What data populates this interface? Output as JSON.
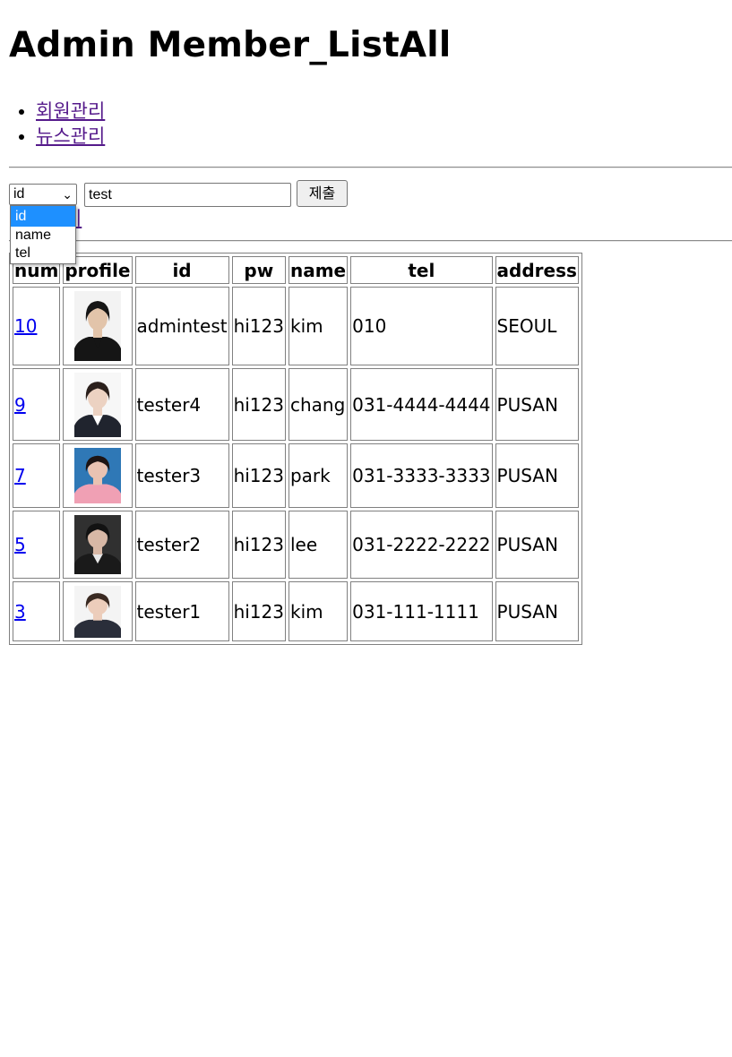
{
  "page": {
    "title": "Admin Member_ListAll"
  },
  "nav": {
    "items": [
      {
        "label": "회원관리"
      },
      {
        "label": "뉴스관리"
      }
    ]
  },
  "search": {
    "selected": "id",
    "options": [
      "id",
      "name",
      "tel"
    ],
    "query": "test",
    "submit_label": "제출",
    "write_link": "작성하기",
    "write_link_visible": "하기"
  },
  "table": {
    "headers": [
      "num",
      "profile",
      "id",
      "pw",
      "name",
      "tel",
      "address"
    ],
    "rows": [
      {
        "num": "10",
        "id": "admintest",
        "pw": "hi123",
        "name": "kim",
        "tel": "010",
        "address": "SEOUL",
        "photo": {
          "bg": "#f3f3f3",
          "hair": "#161616",
          "skin": "#e2c4aa",
          "clothes": "#151515",
          "lapel": "#151515"
        }
      },
      {
        "num": "9",
        "id": "tester4",
        "pw": "hi123",
        "name": "chang",
        "tel": "031-4444-4444",
        "address": "PUSAN",
        "photo": {
          "bg": "#f7f7f7",
          "hair": "#2b201c",
          "skin": "#ecd2c2",
          "clothes": "#20242e",
          "lapel": "#ffffff"
        }
      },
      {
        "num": "7",
        "id": "tester3",
        "pw": "hi123",
        "name": "park",
        "tel": "031-3333-3333",
        "address": "PUSAN",
        "photo": {
          "bg": "#2f78b6",
          "hair": "#1d1414",
          "skin": "#e9c2b2",
          "clothes": "#f0a0b4",
          "lapel": "#f0a0b4"
        }
      },
      {
        "num": "5",
        "id": "tester2",
        "pw": "hi123",
        "name": "lee",
        "tel": "031-2222-2222",
        "address": "PUSAN",
        "photo": {
          "bg": "#303030",
          "hair": "#121212",
          "skin": "#d8b8a6",
          "clothes": "#1a1a1a",
          "lapel": "#e8e8e8"
        }
      },
      {
        "num": "3",
        "id": "tester1",
        "pw": "hi123",
        "name": "kim",
        "tel": "031-111-1111",
        "address": "PUSAN",
        "photo": {
          "bg": "#f4f4f4",
          "hair": "#3a2a22",
          "skin": "#eccdbb",
          "clothes": "#2a2e3a",
          "lapel": "#2a2e3a"
        }
      }
    ]
  }
}
